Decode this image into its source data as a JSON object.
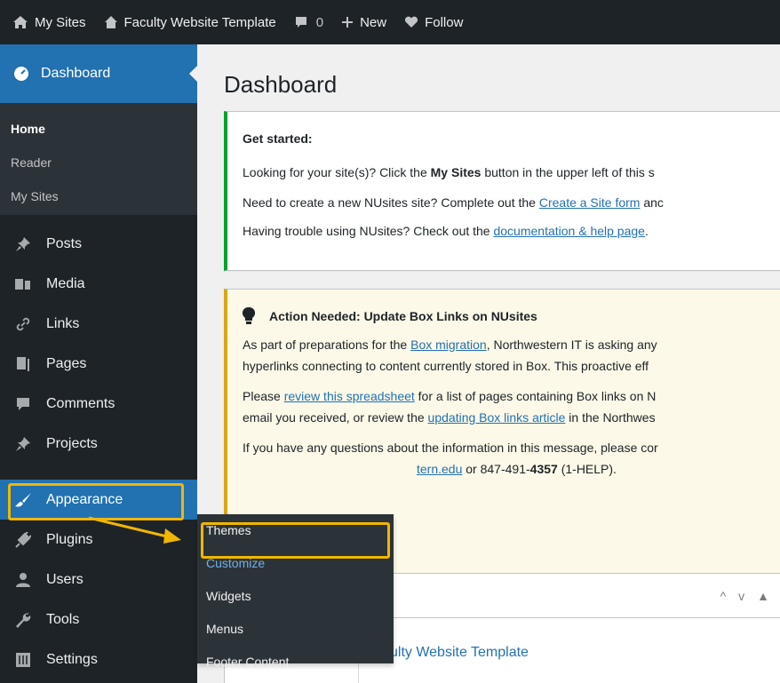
{
  "adminbar": {
    "items": [
      {
        "label": "My Sites",
        "icon": "my-sites-icon"
      },
      {
        "label": "Faculty Website Template",
        "icon": "home-icon"
      },
      {
        "label": "0",
        "icon": "comment-bubble-icon"
      },
      {
        "label": "New",
        "icon": "plus-icon"
      },
      {
        "label": "Follow",
        "icon": "heart-icon"
      }
    ]
  },
  "sidebar": {
    "dashboard": "Dashboard",
    "submenu": [
      "Home",
      "Reader",
      "My Sites"
    ],
    "items": [
      "Posts",
      "Media",
      "Links",
      "Pages",
      "Comments",
      "Projects",
      "Appearance",
      "Plugins",
      "Users",
      "Tools",
      "Settings"
    ]
  },
  "flyout": {
    "items": [
      "Themes",
      "Customize",
      "Widgets",
      "Menus",
      "Footer Content"
    ]
  },
  "main": {
    "title": "Dashboard",
    "get_started": {
      "heading": "Get started:",
      "line1_a": "Looking for your site(s)? Click the ",
      "line1_bold": "My Sites",
      "line1_b": " button in the upper left of this s",
      "line2_a": "Need to create a new NUsites site? Complete out the ",
      "line2_link": "Create a Site form",
      "line2_b": " anc",
      "line3_a": "Having trouble using NUsites? Check out the ",
      "line3_link": "documentation & help page",
      "line3_b": "."
    },
    "action": {
      "heading": "Action Needed: Update Box Links on NUsites",
      "p1_a": "As part of preparations for the ",
      "p1_link": "Box migration",
      "p1_b": ", Northwestern IT is asking any",
      "p1_c": "hyperlinks connecting to content currently stored in Box. This proactive eff",
      "p2_a": "Please ",
      "p2_link": "review this spreadsheet",
      "p2_b": " for a list of pages containing Box links on N",
      "p2_c": "email you received, or review the ",
      "p2_link2": "updating Box links article",
      "p2_d": " in the Northwes",
      "p3_a": "If you have any questions about the information in this message, please cor",
      "p3_link": "tern.edu",
      "p3_b": " or 847-491-",
      "p3_bold": "4357",
      "p3_c": " (1-HELP)."
    },
    "widget": {
      "site": "ulty Website Template",
      "controls": [
        "^",
        "v",
        "▲"
      ]
    }
  },
  "colors": {
    "adminbar": "#1d2327",
    "accent": "#2271b1",
    "highlight": "#f0b700",
    "success": "#00a32a",
    "warning": "#dba617"
  }
}
